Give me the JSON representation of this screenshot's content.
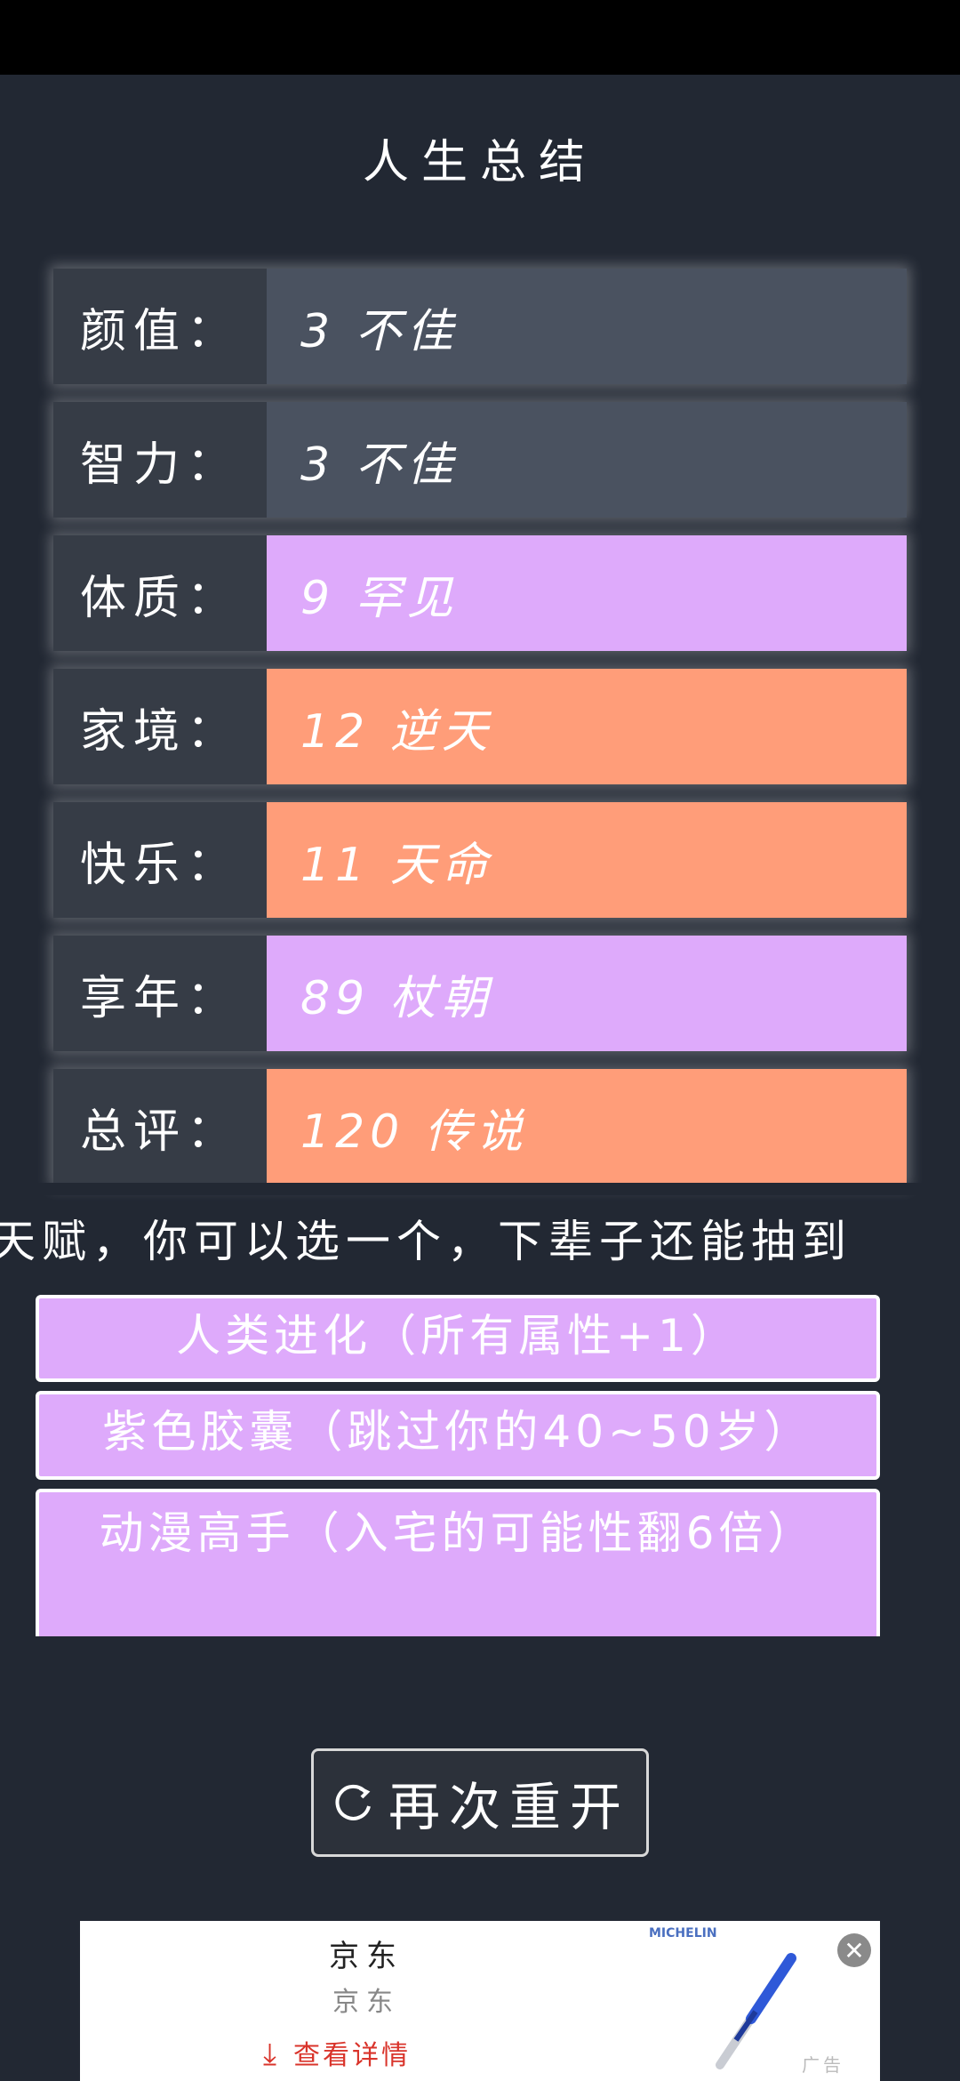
{
  "title": "人生总结",
  "stats": [
    {
      "label": "颜值：",
      "value": "3 不佳",
      "color": "#4a5260"
    },
    {
      "label": "智力：",
      "value": "3 不佳",
      "color": "#4a5260"
    },
    {
      "label": "体质：",
      "value": "9 罕见",
      "color": "#deaafb"
    },
    {
      "label": "家境：",
      "value": "12 逆天",
      "color": "#ff9d79"
    },
    {
      "label": "快乐：",
      "value": "11 天命",
      "color": "#ff9d79"
    },
    {
      "label": "享年：",
      "value": "89 杖朝",
      "color": "#deaafb"
    },
    {
      "label": "总评：",
      "value": "120 传说",
      "color": "#ff9d79"
    }
  ],
  "talent_prompt": "天赋，你可以选一个，下辈子还能抽到",
  "talents": [
    {
      "label": "人类进化（所有属性+1）",
      "color": "#deaafb"
    },
    {
      "label": "紫色胶囊（跳过你的40~50岁）",
      "color": "#deaafb"
    },
    {
      "label": "动漫高手（入宅的可能性翻6倍）",
      "color": "#deaafb"
    }
  ],
  "restart_label": "再次重开",
  "ad": {
    "title": "京东",
    "subtitle": "京东",
    "link_label": "查看详情",
    "brand": "MICHELIN",
    "tag": "广告"
  }
}
